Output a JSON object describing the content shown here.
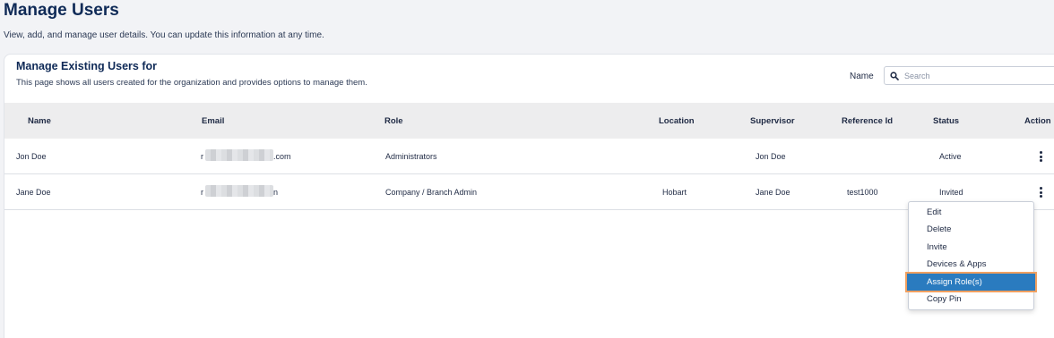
{
  "page": {
    "title": "Manage Users",
    "subtitle": "View, add, and manage user details. You can update this information at any time."
  },
  "card": {
    "title": "Manage Existing Users for",
    "description": "This page shows all users created for the organization and provides options to manage them."
  },
  "search": {
    "label": "Name",
    "placeholder": "Search",
    "value": ""
  },
  "table": {
    "columns": [
      "Name",
      "Email",
      "Role",
      "Location",
      "Supervisor",
      "Reference Id",
      "Status",
      "Action"
    ],
    "rows": [
      {
        "name": "Jon Doe",
        "email_prefix": "r",
        "email_suffix": ".com",
        "role": "Administrators",
        "location": "",
        "supervisor": "Jon Doe",
        "reference_id": "",
        "status": "Active"
      },
      {
        "name": "Jane Doe",
        "email_prefix": "r",
        "email_suffix": "n",
        "role": "Company / Branch Admin",
        "location": "Hobart",
        "supervisor": "Jane Doe",
        "reference_id": "test1000",
        "status": "Invited"
      }
    ]
  },
  "action_menu": {
    "items": [
      "Edit",
      "Delete",
      "Invite",
      "Devices & Apps",
      "Assign Role(s)",
      "Copy Pin"
    ],
    "selected_item": "Assign Role(s)",
    "selected_color": "#2a7bbf",
    "highlight_outline_color": "#f0a060"
  },
  "icons": {
    "search": "search-icon",
    "action": "kebab-menu-icon"
  }
}
